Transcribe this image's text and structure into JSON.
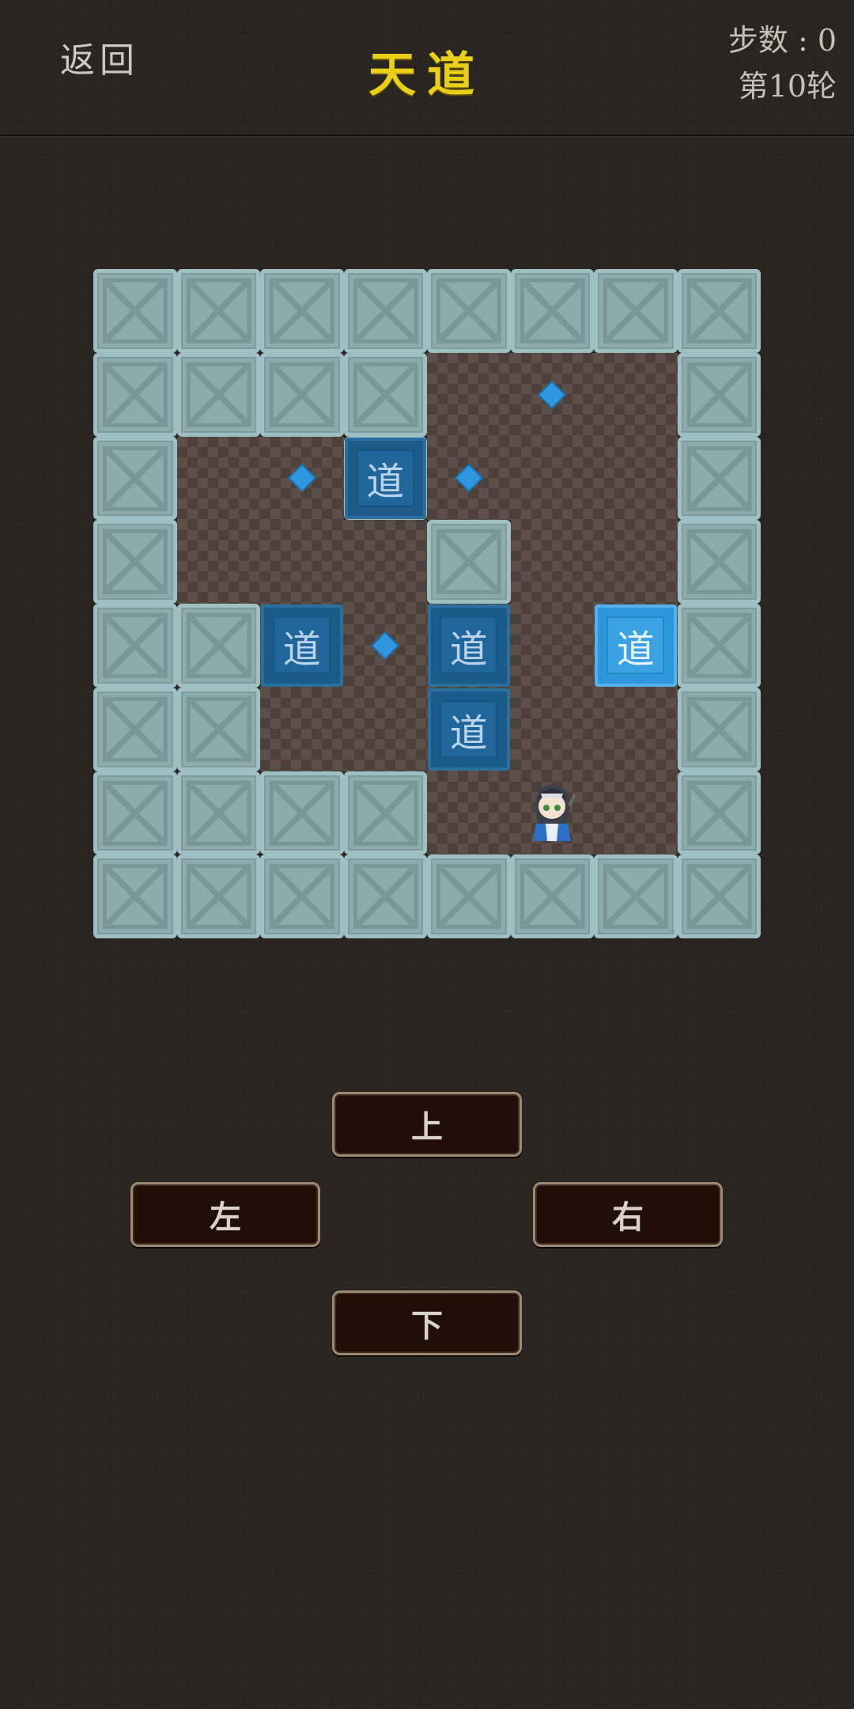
{
  "header": {
    "back_label": "返回",
    "title": "天道",
    "steps_label": "步数 : 0",
    "round_label": "第10轮"
  },
  "board": {
    "rows": 8,
    "cols": 8,
    "grid": [
      "########",
      "####   #",
      "#  #   #",
      "#   #  #",
      "##     #",
      "##     #",
      "####   #",
      "########"
    ],
    "targets": [
      [
        1,
        5
      ],
      [
        2,
        2
      ],
      [
        2,
        4
      ],
      [
        4,
        3
      ],
      [
        4,
        6
      ]
    ],
    "boxes": [
      {
        "row": 2,
        "col": 3,
        "label": "道",
        "on_target": false
      },
      {
        "row": 4,
        "col": 2,
        "label": "道",
        "on_target": false
      },
      {
        "row": 4,
        "col": 4,
        "label": "道",
        "on_target": false
      },
      {
        "row": 4,
        "col": 6,
        "label": "道",
        "on_target": true
      },
      {
        "row": 5,
        "col": 4,
        "label": "道",
        "on_target": false
      }
    ],
    "player": {
      "row": 6,
      "col": 5
    }
  },
  "controls": {
    "up_label": "上",
    "left_label": "左",
    "right_label": "右",
    "down_label": "下"
  },
  "colors": {
    "title": "#e9cf17",
    "wall": "#8eabac",
    "floor": "#5c4f47",
    "box": "#1c5a88",
    "box_on_target": "#2d97dc",
    "target": "#2f97e0"
  }
}
